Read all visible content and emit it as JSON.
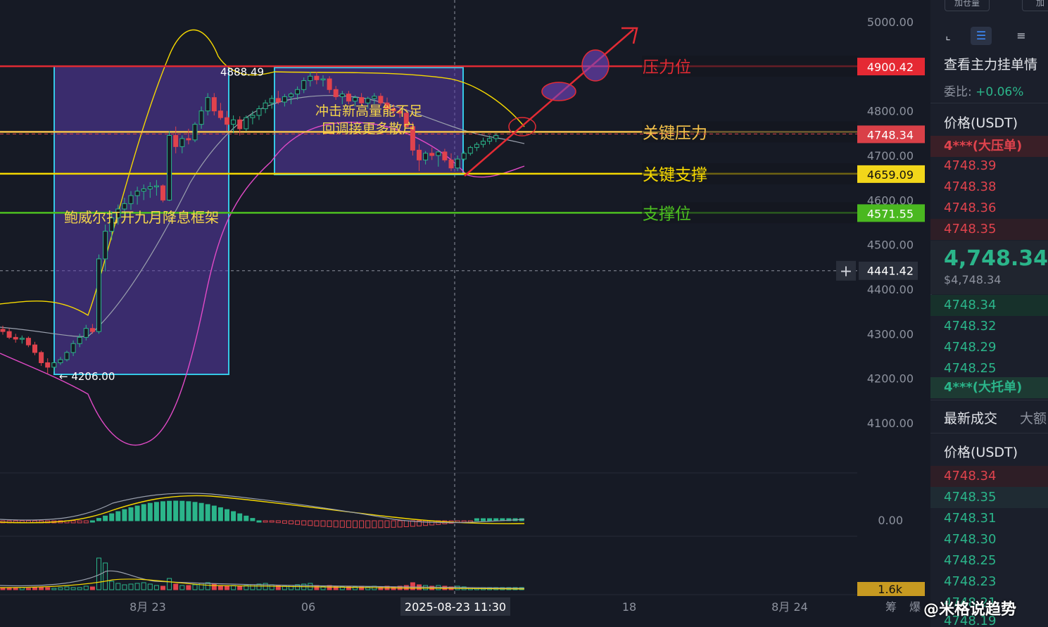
{
  "chart_data": {
    "type": "candlestick",
    "price_axis": {
      "ticks": [
        5000.0,
        4800.0,
        4700.0,
        4600.0,
        4500.0,
        4400.0,
        4300.0,
        4200.0,
        4100.0
      ],
      "ylim": [
        4000,
        5045
      ]
    },
    "time_axis": {
      "labels": [
        "8月 23",
        "06",
        "2025-08-23 11:30",
        "18",
        "8月 24",
        "筹",
        "爆"
      ]
    },
    "macd_axis_label": "0.00",
    "volume_badge": "1.6k",
    "crosshair_price": "4441.42",
    "price_badges": [
      {
        "label": "4900.42",
        "value": 4900.42,
        "color": "#e52933"
      },
      {
        "label": "4748.34",
        "value": 4748.34,
        "color": "#d94048"
      },
      {
        "label": "4659.09",
        "value": 4659.09,
        "color": "#f2d61a"
      },
      {
        "label": "4571.55",
        "value": 4571.55,
        "color": "#4ab820"
      }
    ],
    "level_lines": [
      {
        "name": "压力位",
        "value": 4900.42,
        "color": "#e02a33"
      },
      {
        "name": "关键压力",
        "value": 4753,
        "color": "#f5c24a"
      },
      {
        "name": "关键支撑",
        "value": 4659.09,
        "color": "#f5d800"
      },
      {
        "name": "支撑位",
        "value": 4571.55,
        "color": "#4cc020"
      }
    ],
    "annotations": {
      "box1_text": "鲍威尔打开九月降息框架",
      "box2_text_line1": "冲击新高量能不足",
      "box2_text_line2": "回调接更多散户",
      "high_label": "4888.49",
      "low_label": "4206.00"
    },
    "candles": [
      [
        4310,
        4318,
        4298,
        4305
      ],
      [
        4305,
        4312,
        4288,
        4292
      ],
      [
        4292,
        4300,
        4280,
        4288
      ],
      [
        4288,
        4296,
        4278,
        4290
      ],
      [
        4290,
        4294,
        4270,
        4275
      ],
      [
        4275,
        4282,
        4252,
        4258
      ],
      [
        4258,
        4262,
        4228,
        4235
      ],
      [
        4235,
        4245,
        4210,
        4225
      ],
      [
        4225,
        4240,
        4215,
        4235
      ],
      [
        4235,
        4248,
        4230,
        4242
      ],
      [
        4242,
        4262,
        4238,
        4258
      ],
      [
        4258,
        4285,
        4250,
        4278
      ],
      [
        4278,
        4300,
        4270,
        4292
      ],
      [
        4292,
        4320,
        4285,
        4312
      ],
      [
        4312,
        4322,
        4300,
        4305
      ],
      [
        4305,
        4478,
        4300,
        4468
      ],
      [
        4468,
        4545,
        4440,
        4530
      ],
      [
        4530,
        4575,
        4510,
        4560
      ],
      [
        4560,
        4590,
        4545,
        4580
      ],
      [
        4580,
        4605,
        4560,
        4592
      ],
      [
        4592,
        4620,
        4578,
        4610
      ],
      [
        4610,
        4630,
        4590,
        4620
      ],
      [
        4620,
        4635,
        4600,
        4625
      ],
      [
        4625,
        4640,
        4605,
        4630
      ],
      [
        4630,
        4645,
        4610,
        4632
      ],
      [
        4632,
        4635,
        4595,
        4600
      ],
      [
        4600,
        4755,
        4598,
        4745
      ],
      [
        4745,
        4765,
        4705,
        4720
      ],
      [
        4720,
        4745,
        4705,
        4738
      ],
      [
        4738,
        4760,
        4725,
        4735
      ],
      [
        4735,
        4775,
        4730,
        4770
      ],
      [
        4770,
        4810,
        4760,
        4800
      ],
      [
        4800,
        4840,
        4790,
        4830
      ],
      [
        4830,
        4840,
        4790,
        4800
      ],
      [
        4800,
        4818,
        4780,
        4785
      ],
      [
        4785,
        4800,
        4755,
        4770
      ],
      [
        4770,
        4790,
        4750,
        4780
      ],
      [
        4780,
        4788,
        4745,
        4760
      ],
      [
        4760,
        4790,
        4755,
        4785
      ],
      [
        4785,
        4800,
        4770,
        4790
      ],
      [
        4790,
        4812,
        4780,
        4805
      ],
      [
        4805,
        4825,
        4795,
        4818
      ],
      [
        4818,
        4835,
        4805,
        4828
      ],
      [
        4828,
        4845,
        4815,
        4820
      ],
      [
        4820,
        4838,
        4810,
        4832
      ],
      [
        4832,
        4842,
        4815,
        4838
      ],
      [
        4838,
        4855,
        4825,
        4848
      ],
      [
        4848,
        4875,
        4840,
        4868
      ],
      [
        4868,
        4888,
        4855,
        4878
      ],
      [
        4878,
        4888,
        4860,
        4870
      ],
      [
        4870,
        4880,
        4855,
        4872
      ],
      [
        4872,
        4878,
        4840,
        4848
      ],
      [
        4848,
        4856,
        4825,
        4832
      ],
      [
        4832,
        4845,
        4815,
        4838
      ],
      [
        4838,
        4845,
        4815,
        4822
      ],
      [
        4822,
        4835,
        4810,
        4830
      ],
      [
        4830,
        4840,
        4812,
        4818
      ],
      [
        4818,
        4832,
        4805,
        4828
      ],
      [
        4828,
        4840,
        4815,
        4833
      ],
      [
        4833,
        4840,
        4812,
        4818
      ],
      [
        4818,
        4830,
        4800,
        4805
      ],
      [
        4805,
        4815,
        4790,
        4800
      ],
      [
        4800,
        4812,
        4785,
        4795
      ],
      [
        4795,
        4805,
        4760,
        4765
      ],
      [
        4765,
        4775,
        4700,
        4712
      ],
      [
        4712,
        4725,
        4665,
        4690
      ],
      [
        4690,
        4710,
        4680,
        4705
      ],
      [
        4705,
        4718,
        4690,
        4700
      ],
      [
        4700,
        4712,
        4675,
        4708
      ],
      [
        4708,
        4715,
        4685,
        4690
      ],
      [
        4690,
        4705,
        4665,
        4672
      ],
      [
        4672,
        4700,
        4665,
        4692
      ],
      [
        4692,
        4710,
        4688,
        4705
      ],
      [
        4705,
        4722,
        4700,
        4718
      ],
      [
        4718,
        4730,
        4710,
        4725
      ],
      [
        4725,
        4740,
        4718,
        4732
      ],
      [
        4732,
        4745,
        4725,
        4738
      ],
      [
        4738,
        4750,
        4730,
        4745
      ]
    ]
  },
  "sidebar": {
    "top_buttons": [
      "加仓量",
      "加"
    ],
    "toolbar_icons": [
      "resize-icon",
      "orderbook-both-icon",
      "list-icon"
    ],
    "title": "查看主力挂单情",
    "ratio_label": "委比:",
    "ratio_value": "+0.06%",
    "price_header": "价格(USDT)",
    "big_ask_label": "4***(大压单)",
    "asks": [
      "4748.39",
      "4748.38",
      "4748.36",
      "4748.35"
    ],
    "last_price": "4,748.34",
    "last_price_usd": "$4,748.34",
    "bids": [
      "4748.34",
      "4748.32",
      "4748.29",
      "4748.25"
    ],
    "big_bid_label": "4***(大托单)",
    "trades_tab": "最新成交",
    "trades_tab2": "大额",
    "trades_price_header": "价格(USDT)",
    "trades": [
      {
        "price": "4748.34",
        "side": "sell"
      },
      {
        "price": "4748.35",
        "side": "buy"
      },
      {
        "price": "4748.31",
        "side": "buy"
      },
      {
        "price": "4748.30",
        "side": "buy"
      },
      {
        "price": "4748.25",
        "side": "buy"
      },
      {
        "price": "4748.23",
        "side": "buy"
      },
      {
        "price": "4748.21",
        "side": "buy"
      },
      {
        "price": "4748.19",
        "side": "buy"
      }
    ]
  },
  "watermark": "@米格说趋势"
}
